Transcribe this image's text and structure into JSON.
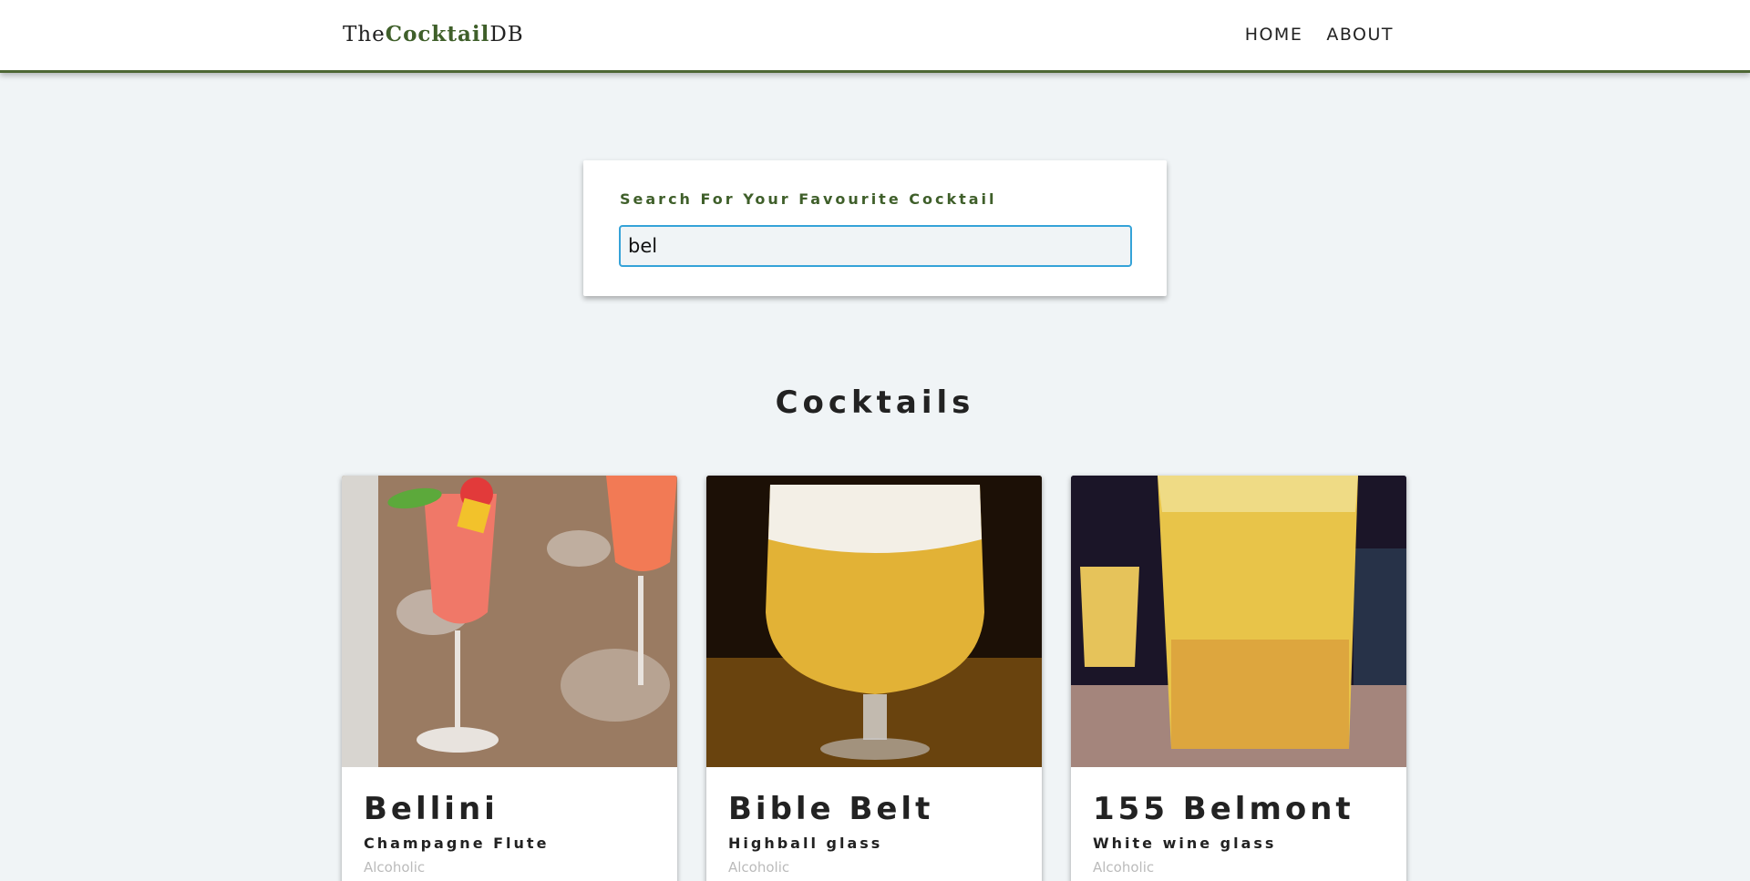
{
  "navbar": {
    "logo_prefix": "The",
    "logo_accent": "Cocktail",
    "logo_suffix": "DB",
    "links": [
      "HOME",
      "ABOUT"
    ]
  },
  "search": {
    "label": "Search For Your Favourite Cocktail",
    "value": "bel"
  },
  "section": {
    "title": "Cocktails"
  },
  "cocktails": [
    {
      "name": "Bellini",
      "glass": "Champagne Flute",
      "type": "Alcoholic"
    },
    {
      "name": "Bible Belt",
      "glass": "Highball glass",
      "type": "Alcoholic"
    },
    {
      "name": "155 Belmont",
      "glass": "White wine glass",
      "type": "Alcoholic"
    }
  ],
  "colors": {
    "accent": "#3f5f2a",
    "focus_border": "#35a3d8",
    "background": "#f0f4f6"
  }
}
